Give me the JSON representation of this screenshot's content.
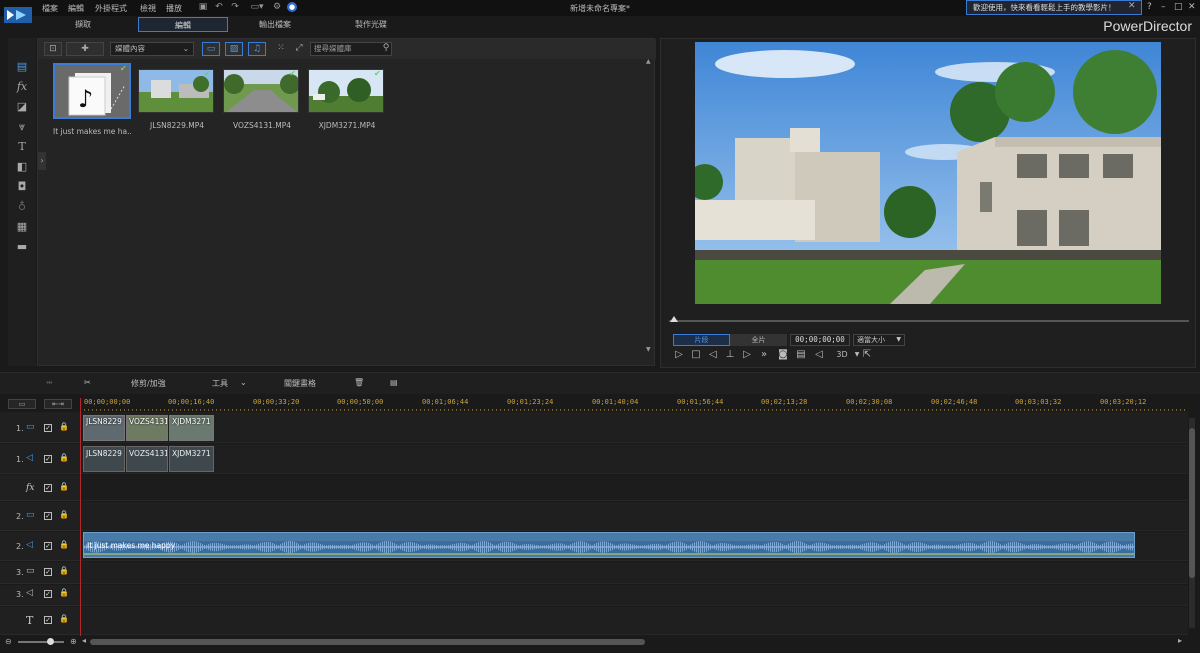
{
  "app": {
    "title": "新增未命名專案*",
    "brand": "PowerDirector",
    "logo_icon": "powerdirector-logo"
  },
  "menu": [
    "檔案",
    "編輯",
    "外掛程式",
    "檢視",
    "播放"
  ],
  "welcome_banner": "歡迎使用，快來看看輕鬆上手的教學影片！",
  "window_buttons": {
    "help": "?",
    "minimize": "–",
    "maximize": "□",
    "close": "✕"
  },
  "mode_tabs": [
    {
      "label": "擷取",
      "active": false
    },
    {
      "label": "編輯",
      "active": true
    },
    {
      "label": "輸出檔案",
      "active": false
    },
    {
      "label": "製作光碟",
      "active": false
    }
  ],
  "library": {
    "filter": "媒體內容",
    "search_placeholder": "搜尋媒體庫",
    "items": [
      {
        "caption": "It just makes me ha...",
        "type": "audio"
      },
      {
        "caption": "JLSN8229.MP4",
        "type": "video"
      },
      {
        "caption": "VOZS4131.MP4",
        "type": "video"
      },
      {
        "caption": "XJDM3271.MP4",
        "type": "video"
      }
    ]
  },
  "preview": {
    "clip_tab": "片段",
    "full_tab": "全片",
    "timecode": "00;00;00;00",
    "fit_size": "適當大小",
    "three_d": "3D"
  },
  "timeline_toolbar": {
    "trim": "修剪/加強",
    "tools": "工具",
    "keyframe": "關鍵畫格"
  },
  "ruler_ticks": [
    "00;00;00;00",
    "00;00;16;40",
    "00;00;33;20",
    "00;00;50;00",
    "00;01;06;44",
    "00;01;23;24",
    "00;01;40;04",
    "00;01;56;44",
    "00;02;13;28",
    "00;02;30;08",
    "00;02;46;48",
    "00;03;03;32",
    "00;03;20;12"
  ],
  "tracks": [
    {
      "num": "1.",
      "kind": "video"
    },
    {
      "num": "1.",
      "kind": "audio"
    },
    {
      "num": "",
      "kind": "fx"
    },
    {
      "num": "2.",
      "kind": "video"
    },
    {
      "num": "2.",
      "kind": "audio"
    },
    {
      "num": "3.",
      "kind": "video"
    },
    {
      "num": "3.",
      "kind": "audio"
    },
    {
      "num": "",
      "kind": "title"
    }
  ],
  "clips": {
    "video": [
      "JLSN8229",
      "VOZS4131",
      "XJDM3271"
    ],
    "audio": [
      "JLSN8229",
      "VOZS4131",
      "XJDM3271"
    ],
    "music": "It just makes me happy"
  },
  "colors": {
    "accent": "#3a7bd5",
    "playhead": "#b3262a",
    "ruler": "#c8a23c",
    "music_clip": "#4a7aa8"
  }
}
